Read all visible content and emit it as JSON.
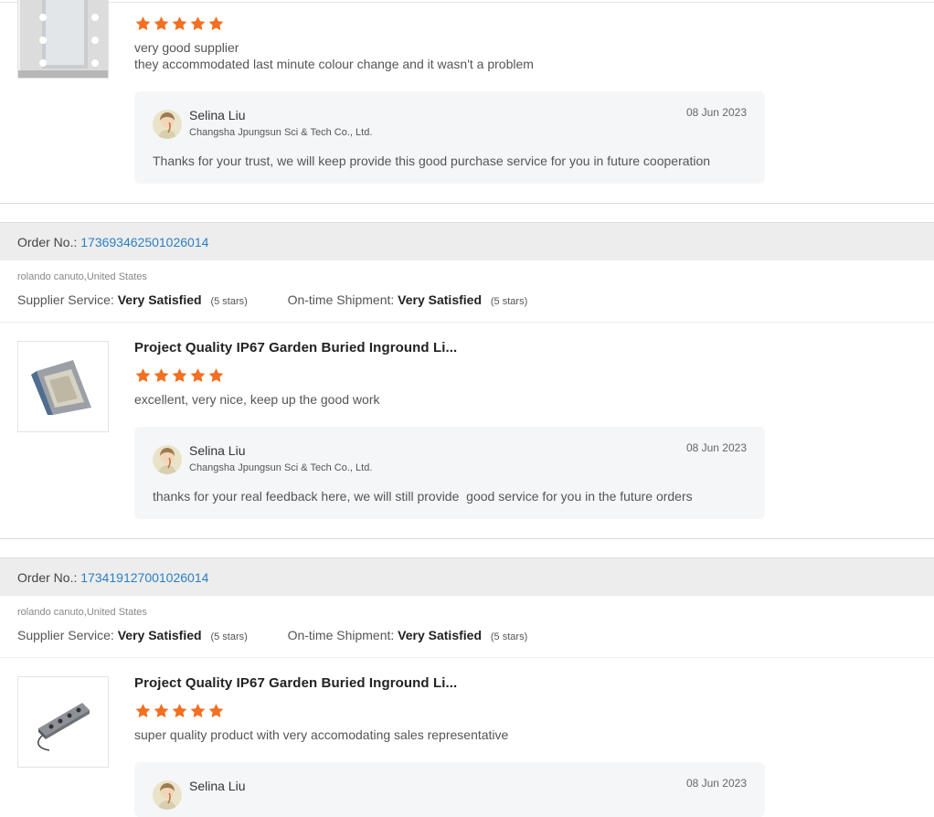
{
  "colors": {
    "star": "#f36f21",
    "link": "#2a7fc4",
    "order_bar": "#ededed",
    "reply_bg": "#f5f6f8"
  },
  "review_top": {
    "stars": 5,
    "text_lines": [
      "very good supplier",
      "they accommodated last minute colour change and it wasn't a problem"
    ],
    "image_icon": "vanity-mirror-image",
    "reply": {
      "name": "Selina Liu",
      "company": "Changsha Jpungsun Sci & Tech Co., Ltd.",
      "date": "08 Jun 2023",
      "text": "Thanks for your trust, we will keep provide this good purchase service for you in future cooperation"
    }
  },
  "orders": [
    {
      "order_label": "Order No.: ",
      "order_no": "173693462501026014",
      "buyer": "rolando canuto,United States",
      "supplier_service_label": "Supplier Service:",
      "supplier_service_value": "Very Satisfied",
      "supplier_service_stars": "(5 stars)",
      "shipment_label": "On-time Shipment:",
      "shipment_value": "Very Satisfied",
      "shipment_stars": "(5 stars)",
      "product_title": "Project Quality IP67 Garden Buried Inground Li...",
      "product_icon": "square-inground-light-image",
      "stars": 5,
      "review": "excellent, very nice, keep up the good work",
      "reply": {
        "name": "Selina Liu",
        "company": "Changsha Jpungsun Sci & Tech Co., Ltd.",
        "date": "08 Jun 2023",
        "text": "thanks for your real feedback here, we will still provide  good service for you in the future orders"
      }
    },
    {
      "order_label": "Order No.: ",
      "order_no": "173419127001026014",
      "buyer": "rolando canuto,United States",
      "supplier_service_label": "Supplier Service:",
      "supplier_service_value": "Very Satisfied",
      "supplier_service_stars": "(5 stars)",
      "shipment_label": "On-time Shipment:",
      "shipment_value": "Very Satisfied",
      "shipment_stars": "(5 stars)",
      "product_title": "Project Quality IP67 Garden Buried Inground Li...",
      "product_icon": "linear-inground-light-image",
      "stars": 5,
      "review": "super quality product with very accomodating sales representative",
      "reply": {
        "name": "Selina Liu",
        "company": "",
        "date": "08 Jun 2023",
        "text": ""
      }
    }
  ]
}
